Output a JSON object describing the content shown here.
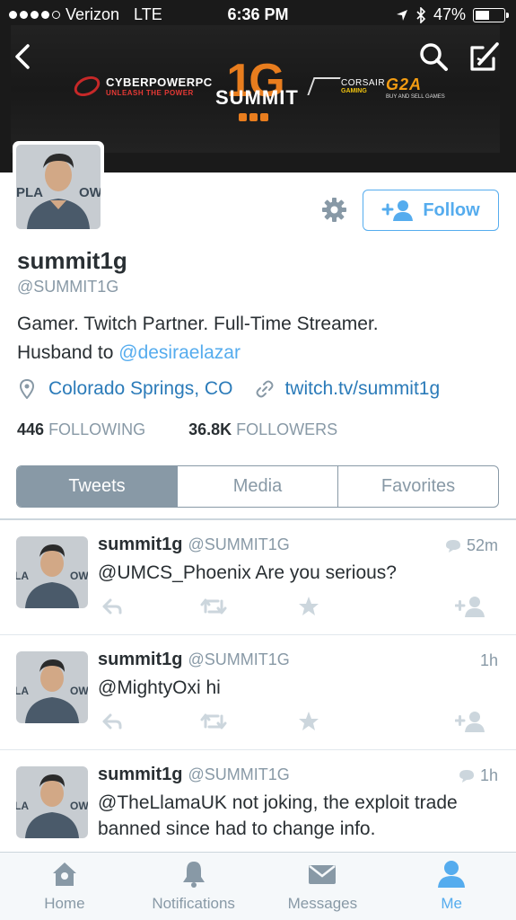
{
  "status_bar": {
    "carrier": "Verizon",
    "network": "LTE",
    "time": "6:36 PM",
    "battery": "47%",
    "battery_level": 0.47
  },
  "banner": {
    "sponsor_cyber": "CYBERPOWERPC",
    "sponsor_cyber_tag": "UNLEASH THE POWER",
    "summit_mark": "1G",
    "summit_word": "SUMMIT",
    "sponsor_corsair": "CORSAIR",
    "sponsor_corsair_tag": "GAMING",
    "sponsor_g2a": "G2A",
    "sponsor_g2a_tag": "BUY AND SELL GAMES"
  },
  "profile": {
    "name": "summit1g",
    "handle": "@SUMMIT1G",
    "bio_line1": "Gamer. Twitch Partner. Full-Time Streamer.",
    "bio_line2_prefix": "Husband to ",
    "bio_mention": "@desiraelazar",
    "location": "Colorado Springs, CO",
    "website": "twitch.tv/summit1g",
    "following_count": "446",
    "following_label": "FOLLOWING",
    "followers_count": "36.8K",
    "followers_label": "FOLLOWERS",
    "follow_label": "Follow"
  },
  "tabs": [
    "Tweets",
    "Media",
    "Favorites"
  ],
  "tweets": [
    {
      "name": "summit1g",
      "handle": "@SUMMIT1G",
      "time": "52m",
      "text": "@UMCS_Phoenix Are you serious?"
    },
    {
      "name": "summit1g",
      "handle": "@SUMMIT1G",
      "time": "1h",
      "text": "@MightyOxi hi"
    },
    {
      "name": "summit1g",
      "handle": "@SUMMIT1G",
      "time": "1h",
      "text": "@TheLlamaUK not joking, the exploit trade banned since had to change info."
    }
  ],
  "tabbar": [
    "Home",
    "Notifications",
    "Messages",
    "Me"
  ],
  "colors": {
    "accent": "#55acee",
    "muted": "#8899a6",
    "text": "#292f33",
    "summit_orange": "#e87d1e"
  }
}
